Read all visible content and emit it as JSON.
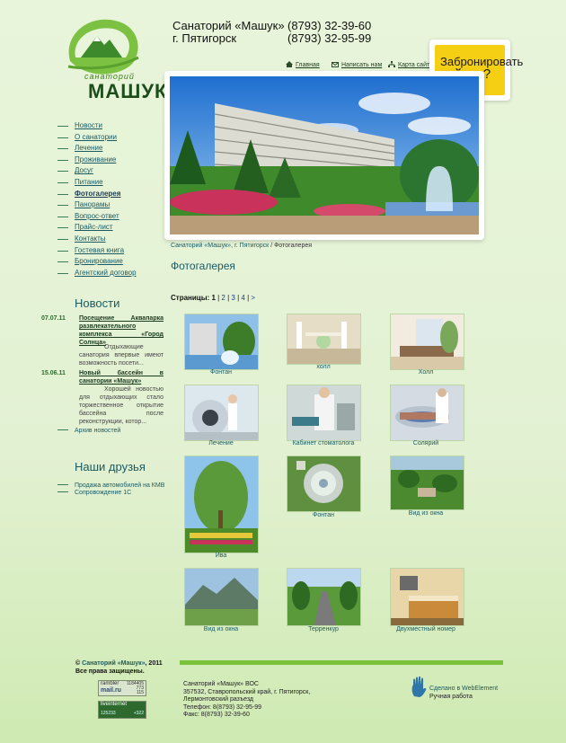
{
  "header": {
    "brand_small": "санаторий",
    "brand": "МАШУК",
    "name_line1": "Санаторий «Машук»",
    "name_line2": "г. Пятигорск",
    "phone1": "(8793) 32-39-60",
    "phone2": "(8793) 32-95-99",
    "nav": [
      {
        "label": "Главная",
        "icon": "home-icon"
      },
      {
        "label": "Написать нам",
        "icon": "mail-icon"
      },
      {
        "label": "Карта сайта",
        "icon": "sitemap-icon"
      }
    ],
    "book_line1": "Забронировать",
    "book_line2": "сейчас?"
  },
  "breadcrumb": {
    "home": "Санаторий «Машук», г. Пятигорск",
    "sep": " / ",
    "current": "Фотогалерея"
  },
  "page_title": "Фотогалерея",
  "pagination": {
    "label": "Страницы:",
    "current": "1",
    "pages": [
      "2",
      "3",
      "4"
    ],
    "next": ">",
    "sep": " | "
  },
  "menu": [
    "Новости",
    "О санатории",
    "Лечение",
    "Проживание",
    "Досуг",
    "Питание",
    "Фотогалерея",
    "Панорамы",
    "Вопрос-ответ",
    "Прайс-лист",
    "Контакты",
    "Гостевая книга",
    "Бронирование",
    "Агентский договор"
  ],
  "menu_active": "Фотогалерея",
  "news": {
    "heading": "Новости",
    "items": [
      {
        "date": "07.07.11",
        "title": "Посещение Аквапарка развлекательного комплекса «Город Солнца»",
        "text": "Отдыхающие санатория впервые имеют возможность посети..."
      },
      {
        "date": "15.06.11",
        "title": "Новый бассейн в санатории «Машук»",
        "text": "Хорошей новостью для отдыхающих стало торжественное открытие бассейна после реконструкции, котор..."
      }
    ],
    "archive": "Архив новостей"
  },
  "friends": {
    "heading": "Наши друзья",
    "links": [
      "Продажа автомобилей на КМВ",
      "Сопровождение 1С"
    ]
  },
  "gallery": [
    {
      "caption": "Фонтан"
    },
    {
      "caption": "холл"
    },
    {
      "caption": "Холл"
    },
    {
      "caption": "Лечение"
    },
    {
      "caption": "Кабинет стоматолога"
    },
    {
      "caption": "Солярий"
    },
    {
      "caption": "Ива"
    },
    {
      "caption": "Фонтан"
    },
    {
      "caption": "Вид из окна"
    },
    {
      "caption": "Вид из окна"
    },
    {
      "caption": "Терренкур"
    },
    {
      "caption": "Двухместный номер"
    }
  ],
  "footer": {
    "copy_prefix": "©",
    "copy_link": "Санаторий «Машук»",
    "copy_year": ", 2011",
    "rights": "Все права защищены.",
    "addr": [
      "Санаторий «Машук» ВОС",
      "357532, Ставропольский край, г. Пятигорск,",
      "Лермонтовский разъезд",
      "Телефон: 8(8793) 32-95-99",
      "Факс: 8(8793) 32-39-60"
    ],
    "made_link": "Сделано в WebElement",
    "made_sub": "Ручная работа",
    "counter1_label": "rambler",
    "counter1_values": [
      "1184405",
      "773",
      "115"
    ],
    "counter2_label": "mail.ru",
    "counter3_label": "liveinternet",
    "counter3_values": [
      "125233",
      "+322"
    ]
  },
  "colors": {
    "accent": "#1b5b63",
    "green": "#7bc23c",
    "yellow": "#f5cf14"
  }
}
